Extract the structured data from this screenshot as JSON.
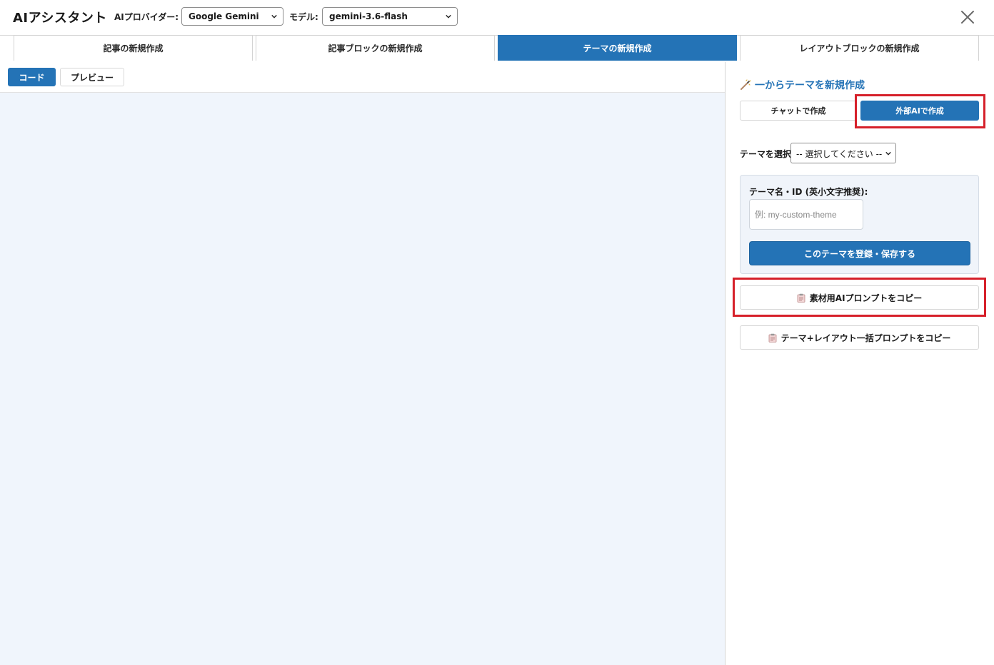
{
  "header": {
    "app_title": "AIアシスタント",
    "provider_label": "AIプロバイダー:",
    "provider_value": "Google Gemini",
    "model_label": "モデル:",
    "model_value": "gemini-3.6-flash"
  },
  "tabs": [
    {
      "label": "記事の新規作成",
      "active": false
    },
    {
      "label": "記事ブロックの新規作成",
      "active": false
    },
    {
      "label": "テーマの新規作成",
      "active": true
    },
    {
      "label": "レイアウトブロックの新規作成",
      "active": false
    }
  ],
  "editor": {
    "code_button": "コード",
    "preview_button": "プレビュー"
  },
  "panel": {
    "title": "一からテーマを新規作成",
    "mode_chat": "チャットで作成",
    "mode_external": "外部AIで作成",
    "theme_select_label": "テーマを選択",
    "theme_select_value": "-- 選択してください --",
    "theme_name_label": "テーマ名・ID (英小文字推奨):",
    "theme_name_placeholder": "例: my-custom-theme",
    "save_button": "このテーマを登録・保存する",
    "copy_material_prompt": "素材用AIプロンプトをコピー",
    "copy_bulk_prompt": "テーマ+レイアウト一括プロンプトをコピー"
  },
  "colors": {
    "accent": "#2473b6",
    "highlight": "#d6202a",
    "editor_bg": "#f0f5fc"
  },
  "icons": [
    "chevron-down-icon",
    "close-icon",
    "magic-wand-icon",
    "clipboard-icon"
  ]
}
